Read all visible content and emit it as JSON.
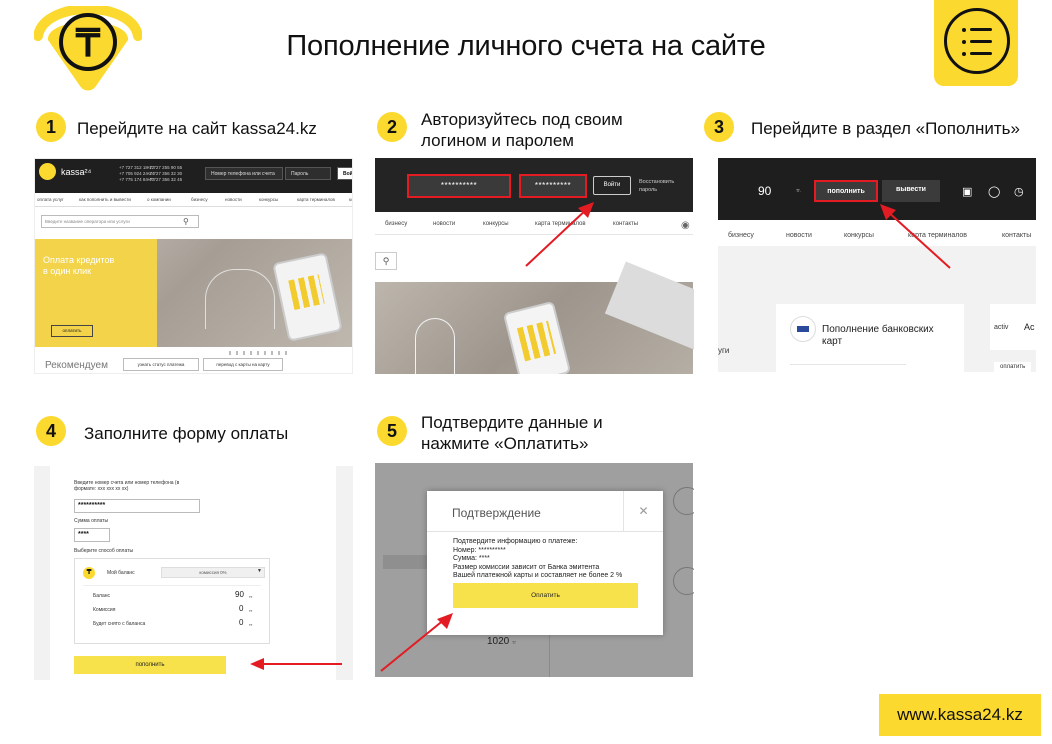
{
  "header": {
    "title": "Пополнение личного счета на сайте",
    "logo_glyph": "₸",
    "menu_icon": "menu-list-icon",
    "accent_color": "#fbd92f"
  },
  "steps": [
    {
      "number": "1",
      "title": "Перейдите на сайт kassa24.kz"
    },
    {
      "number": "2",
      "title_line1": "Авторизуйтесь под своим",
      "title_line2": "логином и паролем"
    },
    {
      "number": "3",
      "title": "Перейдите в раздел «Пополнить»"
    },
    {
      "number": "4",
      "title": "Заполните форму оплаты"
    },
    {
      "number": "5",
      "title_line1": "Подтвердите данные и",
      "title_line2": "нажмите «Оплатить»"
    }
  ],
  "shot1": {
    "brand": "kassa²⁴",
    "phones_a": [
      "+7 727 312 18 12",
      "+7 705 924 24 24",
      "+7 775 174 84 40"
    ],
    "phones_b": [
      "+7 727 255 90 55",
      "+7 727 356 32 30",
      "+7 727 356 32 45"
    ],
    "phone_placeholder": "Номер телефона или счета",
    "password_placeholder": "Пароль",
    "login_button": "Войти",
    "nav": [
      "оплата услуг",
      "как пополнить и вывести",
      "о компании",
      "бизнесу",
      "новости",
      "конкурсы",
      "карта терминалов",
      "ко"
    ],
    "search_placeholder": "Введите название оператора или услуги",
    "hero_text_line1": "Оплата кредитов",
    "hero_text_line2": "в один клик",
    "hero_button": "оплатить",
    "recommend": "Рекомендуем",
    "rec_button_1": "узнать статус платежа",
    "rec_button_2": "перевод с карты на карту"
  },
  "shot2": {
    "login_value": "**********",
    "password_value": "**********",
    "login_button": "Войти",
    "restore_line1": "Восстановить",
    "restore_line2": "пароль",
    "nav": [
      "бизнесу",
      "новости",
      "конкурсы",
      "карта терминалов",
      "контакты"
    ]
  },
  "shot3": {
    "balance": "90",
    "currency": "тг.",
    "topup_button": "пополнить",
    "withdraw_button": "вывести",
    "nav": [
      "бизнесу",
      "новости",
      "конкурсы",
      "карта терминалов",
      "контакты"
    ],
    "card_title_line1": "Пополнение банковских",
    "card_title_line2": "карт",
    "card_side": "activ",
    "card_side_cut": "Ac",
    "left_cut_1": "уги",
    "left_cut_2": "",
    "pay_cut": "оплатить"
  },
  "shot4": {
    "phone_label_line1": "Введите номер счета или номер телефона (в",
    "phone_label_line2": "формате: ххх ххх хх хх)",
    "phone_value": "**********",
    "amount_label": "Сумма оплаты",
    "amount_value": "****",
    "method_label": "Выберите способ оплаты",
    "method_name": "Мой баланс",
    "method_fee": "комиссия 0%",
    "rows": [
      {
        "label": "Баланс",
        "value": "90",
        "unit": "тг"
      },
      {
        "label": "Комиссия",
        "value": "0",
        "unit": "тг"
      },
      {
        "label": "Будет снято с баланса",
        "value": "0",
        "unit": "тг"
      }
    ],
    "submit_button": "пополнить"
  },
  "shot5": {
    "dialog_title": "Подтверждение",
    "close_icon_glyph": "✕",
    "lines": [
      "Подтвердите информацию о платеже:",
      "Номер: **********",
      "Сумма: ****",
      "Размер комиссии зависит от Банка эмитента",
      "Вашей платежной карты и составляет не более 2 %"
    ],
    "pay_button": "Оплатить",
    "amount": "1020",
    "amount_unit": "тг"
  },
  "footer": {
    "site": "www.kassa24.kz"
  }
}
